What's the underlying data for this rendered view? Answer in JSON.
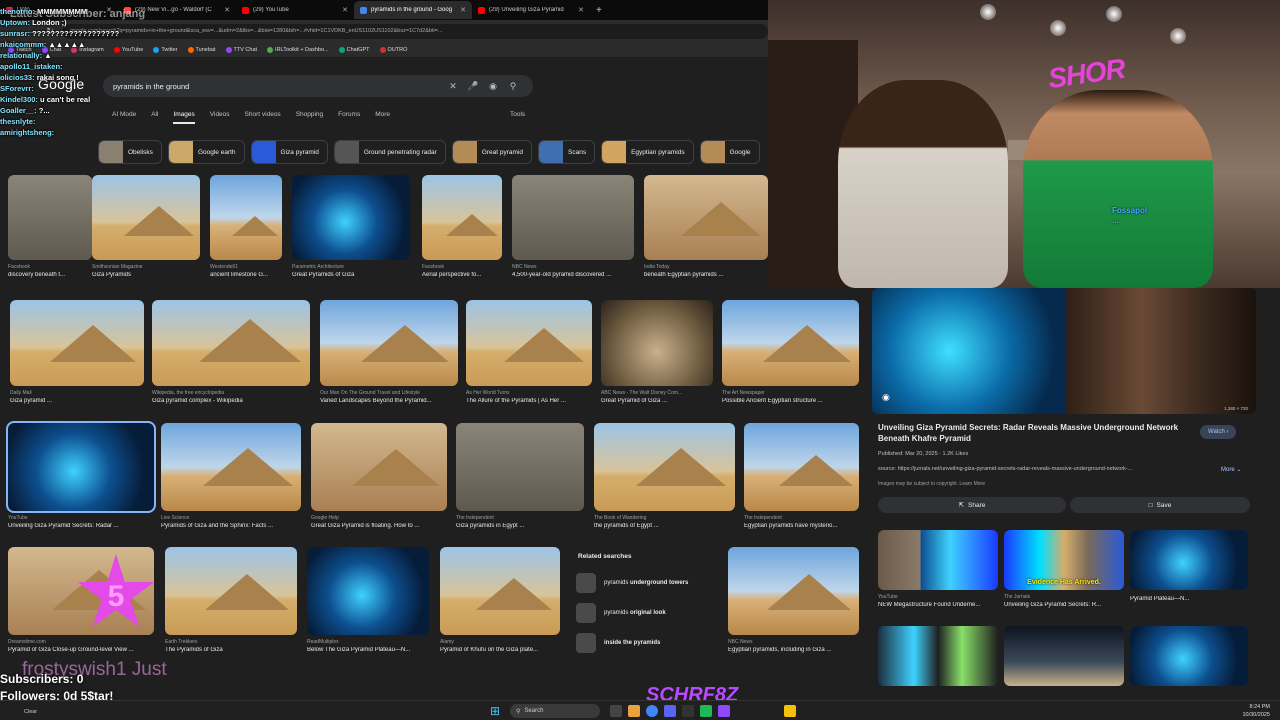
{
  "browser": {
    "tabs": [
      {
        "label": "Upto...",
        "color": "#e24"
      },
      {
        "label": "(29) New Vi...go - Waldorf (C",
        "color": "#f44"
      },
      {
        "label": "(29) YouTube",
        "color": "#f00"
      },
      {
        "label": "pyramids in the ground - Goog",
        "color": "#4285f4",
        "active": true
      },
      {
        "label": "(29) Unveiling Giza Pyramid",
        "color": "#f00"
      }
    ],
    "url": "google.com/search?q=pyramids+in+the+ground&sca_esv=...&udm=2&tbs=...&biw=1280&bih=...#vhid=1C1VDKB_enUS1102US1102&bsz=1C7d2&bti=...",
    "bookmarks": [
      "Twitch",
      "Chat",
      "Instagram",
      "YouTube",
      "Twitter",
      "Tunebat",
      "TTV Chat",
      "IRLToolkit + Dashbo...",
      "ChatGPT",
      "OUTRO"
    ]
  },
  "google": {
    "logo": "Google",
    "query": "pyramids in the ground",
    "tabs": [
      "AI Mode",
      "All",
      "Images",
      "Videos",
      "Short videos",
      "Shopping",
      "Forums",
      "More"
    ],
    "active_tab": "Images",
    "tools": "Tools",
    "chips": [
      "Obelisks",
      "Google earth",
      "Giza pyramid",
      "Ground penetrating radar",
      "Great pyramid",
      "Scans",
      "Egyptian pyramids",
      "Google"
    ],
    "results": [
      {
        "source": "Facebook",
        "title": "discovery beneath t..."
      },
      {
        "source": "Smithsonian Magazine",
        "title": "Giza Pyramids"
      },
      {
        "source": "Westende61",
        "title": "ancient limestone G..."
      },
      {
        "source": "Parametric Architecture",
        "title": "Great Pyramids of Giza"
      },
      {
        "source": "Facebook",
        "title": "Aerial perspective fo..."
      },
      {
        "source": "NBC News",
        "title": "4,500-year-old pyramid discovered ..."
      },
      {
        "source": "India Today",
        "title": "beneath Egyptian pyramids ..."
      },
      {
        "source": "Daily Mail",
        "title": "Giza pyramid ..."
      },
      {
        "source": "Wikipedia, the free encyclopedia",
        "title": "Giza pyramid complex - Wikipedia"
      },
      {
        "source": "Our Man On The Ground Travel and Lifestyle",
        "title": "Varied Landscapes Beyond the Pyramid..."
      },
      {
        "source": "As Her World Turns",
        "title": "The Allure of the Pyramids | As Her ..."
      },
      {
        "source": "ABC News - The Walt Disney Com...",
        "title": "Great Pyramid of Giza ..."
      },
      {
        "source": "The Art Newspaper",
        "title": "Possible Ancient Egyptian structure ..."
      },
      {
        "source": "YouTube",
        "title": "Unveiling Giza Pyramid Secrets: Radar ..."
      },
      {
        "source": "Live Science",
        "title": "Pyramids of Giza and the Sphinx: Facts ..."
      },
      {
        "source": "Google Help",
        "title": "Great Giza Pyramid is floating. How to ..."
      },
      {
        "source": "The Independent",
        "title": "Giza pyramids in Egypt ..."
      },
      {
        "source": "The Book of Wandering",
        "title": "the pyramids of Egypt ..."
      },
      {
        "source": "The Independent",
        "title": "Egyptian pyramids have mysterio..."
      },
      {
        "source": "Dreamstime.com",
        "title": "Pyramid of Giza Close-up Ground-level View ..."
      },
      {
        "source": "Earth Trekkers",
        "title": "The Pyramids of Giza"
      },
      {
        "source": "ReadMultiplex",
        "title": "Below The Giza Pyramid Plateau—N..."
      },
      {
        "source": "Alamy",
        "title": "Pyramid of Khufu on the Giza plate..."
      },
      {
        "source": "NBC News",
        "title": "Egyptian pyramids, including in Giza ..."
      }
    ],
    "related": {
      "heading": "Related searches",
      "items": [
        {
          "plain": "pyramids ",
          "bold": "underground towers"
        },
        {
          "plain": "pyramids ",
          "bold": "original look"
        },
        {
          "plain": "",
          "bold": "inside the pyramids"
        }
      ]
    }
  },
  "preview": {
    "dims": "1,280 × 720",
    "title": "Unveiling Giza Pyramid Secrets: Radar Reveals Massive Underground Network Beneath Khafre Pyramid",
    "watch": "Watch",
    "meta": "Published: Mar 20, 2025 · 1.2K Likes",
    "source": "source: https://jurnals.net/unveiling-giza-pyramid-secrets-radar-reveals-massive-underground-network-...",
    "more": "More",
    "copyright": "Images may be subject to copyright. Learn More",
    "share": "Share",
    "save": "Save",
    "related": [
      {
        "source": "YouTube",
        "title": "NEW Megastructure Found Underne..."
      },
      {
        "source": "The Jurnals",
        "title": "Unveiling Giza Pyramid Secrets: R..."
      },
      {
        "source": "",
        "title": "Pyramid Plateau—N..."
      }
    ],
    "evidence": "Evidence Has Arrived."
  },
  "stream": {
    "latest": "Latest Subscriber: anjang",
    "chat": [
      {
        "name": "thenotrio:",
        "msg": "MMMMMMMM"
      },
      {
        "name": "Uptown:",
        "msg": "London ;)"
      },
      {
        "name": "sunrasr:",
        "msg": "???????????????????"
      },
      {
        "name": "nkaicommm:",
        "msg": "▲▲▲▲▲"
      },
      {
        "name": "relationally:",
        "msg": "▲"
      },
      {
        "name": "apollo11_istaken:",
        "msg": ""
      },
      {
        "name": "olicios33:",
        "msg": "rakai song !"
      },
      {
        "name": "SForevrr:",
        "msg": ""
      },
      {
        "name": "Kindel300:",
        "msg": "u can't be real"
      },
      {
        "name": "Goaller__:",
        "msg": "?..."
      },
      {
        "name": "thesnlyte:",
        "msg": ""
      },
      {
        "name": "amirightsheng:",
        "msg": ""
      }
    ],
    "subs": "Subscribers: 0",
    "followers": "Followers: 0",
    "ticker": "frostyswish1 Just",
    "ticker2": "d 5$tar!",
    "star_num": "5",
    "cam_logo": "SHOR",
    "cam_alert_name": "Fossapol",
    "cam_alert_msg": "...",
    "brand": "SCHRF8Z"
  },
  "taskbar": {
    "search": "Search",
    "time": "8:24 PM",
    "date": "10/30/2025",
    "clear": "Clear"
  }
}
